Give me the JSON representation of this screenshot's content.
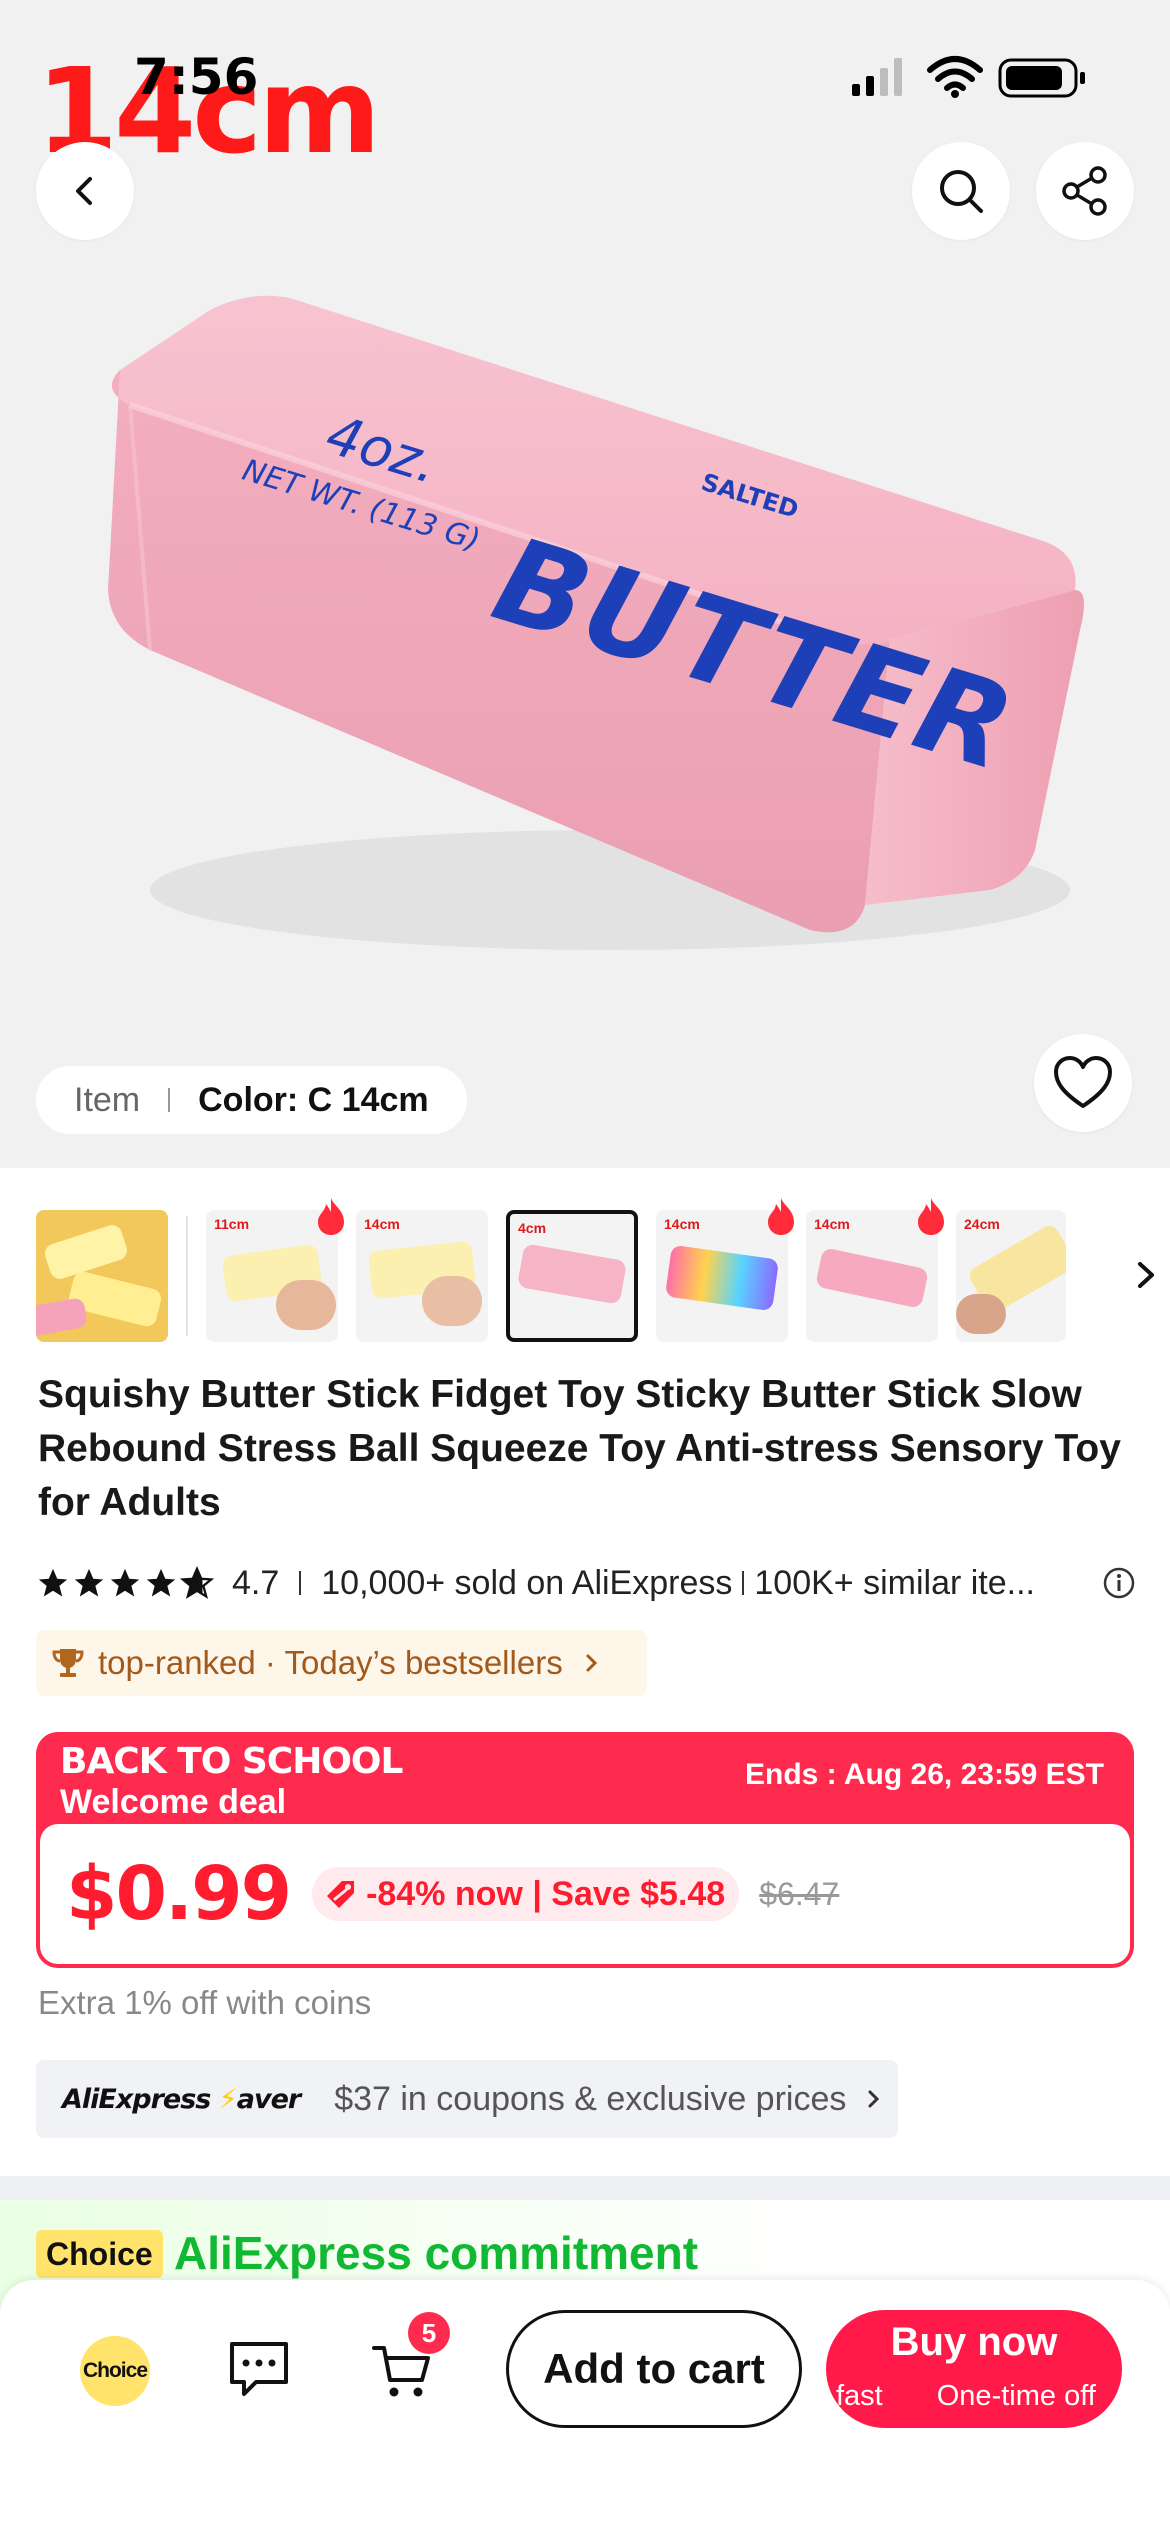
{
  "status_bar": {
    "time": "7:56"
  },
  "hero": {
    "caption": "14cm",
    "product_print": {
      "weight": "4oz.",
      "net_wt": "NET WT. (113 G)",
      "salted": "SALTED",
      "brand_word": "BUTTER"
    },
    "variant": {
      "item_label": "Item",
      "color_label": "Color: C 14cm"
    }
  },
  "thumbnails": [
    {
      "label": "",
      "hot": false,
      "selected": false
    },
    {
      "label": "11cm",
      "hot": true,
      "selected": false
    },
    {
      "label": "14cm",
      "hot": false,
      "selected": false
    },
    {
      "label": "4cm",
      "hot": false,
      "selected": true
    },
    {
      "label": "14cm",
      "hot": true,
      "selected": false
    },
    {
      "label": "14cm",
      "hot": true,
      "selected": false
    },
    {
      "label": "24cm",
      "hot": false,
      "selected": false
    }
  ],
  "product": {
    "title": "Squishy Butter Stick Fidget Toy Sticky Butter Stick Slow Rebound Stress Ball Squeeze Toy Anti-stress Sensory Toy for Adults",
    "rating": "4.7",
    "sold": "10,000+ sold on AliExpress",
    "similar": "100K+ similar ite...",
    "ranked": "top-ranked · Today’s bestsellers"
  },
  "deal": {
    "line1": "BACK TO SCHOOL",
    "line2": "Welcome deal",
    "ends": "Ends : Aug 26, 23:59 EST",
    "price": "$0.99",
    "discount": "-84% now | Save $5.48",
    "original_price": "$6.47"
  },
  "coins_text": "Extra 1% off with coins",
  "saver": {
    "logo_prefix": "AliExpress",
    "logo_suffix": "aver",
    "text": "$37 in coupons & exclusive prices"
  },
  "commitment": {
    "badge": "Choice",
    "title": "AliExpress commitment"
  },
  "bottom_bar": {
    "choice_label": "Choice",
    "cart_count": "5",
    "add_to_cart": "Add to cart",
    "buy_now": "Buy now",
    "buy_sub_1": "fast",
    "buy_sub_2": "One-time off"
  },
  "colors": {
    "accent_red": "#ff2b4f",
    "price_red": "#fe1c2e",
    "choice_yellow": "#ffe36b",
    "commit_green": "#11b832",
    "product_pink": "#f5b5c6",
    "print_blue": "#1d3fb8"
  }
}
